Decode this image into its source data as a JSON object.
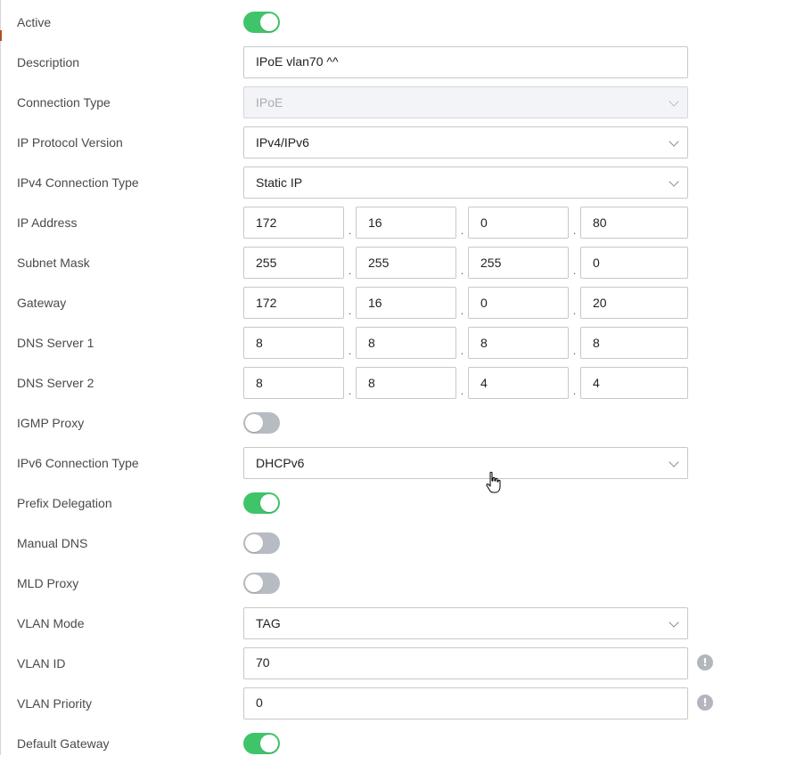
{
  "form": {
    "active": {
      "label": "Active",
      "state": "on"
    },
    "description": {
      "label": "Description",
      "value": "IPoE vlan70 ^^"
    },
    "connection_type": {
      "label": "Connection Type",
      "value": "IPoE",
      "disabled": true
    },
    "ip_protocol_version": {
      "label": "IP Protocol Version",
      "value": "IPv4/IPv6"
    },
    "ipv4_connection_type": {
      "label": "IPv4 Connection Type",
      "value": "Static IP"
    },
    "ip_address": {
      "label": "IP Address",
      "octets": [
        "172",
        "16",
        "0",
        "80"
      ]
    },
    "subnet_mask": {
      "label": "Subnet Mask",
      "octets": [
        "255",
        "255",
        "255",
        "0"
      ]
    },
    "gateway": {
      "label": "Gateway",
      "octets": [
        "172",
        "16",
        "0",
        "20"
      ]
    },
    "dns_server_1": {
      "label": "DNS Server 1",
      "octets": [
        "8",
        "8",
        "8",
        "8"
      ]
    },
    "dns_server_2": {
      "label": "DNS Server 2",
      "octets": [
        "8",
        "8",
        "4",
        "4"
      ]
    },
    "igmp_proxy": {
      "label": "IGMP Proxy",
      "state": "off"
    },
    "ipv6_connection_type": {
      "label": "IPv6 Connection Type",
      "value": "DHCPv6"
    },
    "prefix_delegation": {
      "label": "Prefix Delegation",
      "state": "on"
    },
    "manual_dns": {
      "label": "Manual DNS",
      "state": "off"
    },
    "mld_proxy": {
      "label": "MLD Proxy",
      "state": "off"
    },
    "vlan_mode": {
      "label": "VLAN Mode",
      "value": "TAG"
    },
    "vlan_id": {
      "label": "VLAN ID",
      "value": "70",
      "info_icon": "exclamation-info-icon"
    },
    "vlan_priority": {
      "label": "VLAN Priority",
      "value": "0",
      "info_icon": "exclamation-info-icon"
    },
    "default_gateway": {
      "label": "Default Gateway",
      "state": "on"
    }
  },
  "separator": ".",
  "info_glyph": "!",
  "colors": {
    "toggle_on": "#3fc46a",
    "toggle_off": "#b7bcc2",
    "input_border": "#c8c8c8",
    "disabled_bg": "#f3f4f7",
    "label_text": "#4a4a4a"
  }
}
